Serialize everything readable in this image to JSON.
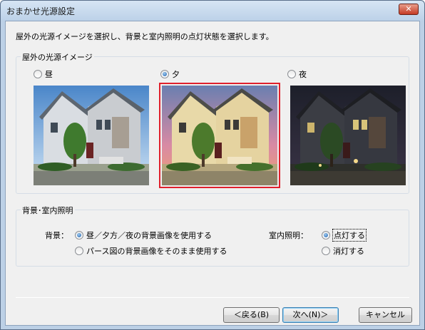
{
  "window": {
    "title": "おまかせ光源設定",
    "close_glyph": "✕"
  },
  "instruction": "屋外の光源イメージを選択し、背景と室内照明の点灯状態を選択します。",
  "light_group": {
    "label": "屋外の光源イメージ",
    "options": [
      {
        "label": "昼",
        "selected": false
      },
      {
        "label": "夕",
        "selected": true
      },
      {
        "label": "夜",
        "selected": false
      }
    ]
  },
  "bg_group": {
    "label": "背景･室内照明",
    "background": {
      "label": "背景：",
      "options": [
        {
          "label": "昼／夕方／夜の背景画像を使用する",
          "selected": true
        },
        {
          "label": "パース図の背景画像をそのまま使用する",
          "selected": false
        }
      ]
    },
    "interior": {
      "label": "室内照明：",
      "options": [
        {
          "label": "点灯する",
          "selected": true
        },
        {
          "label": "消灯する",
          "selected": false
        }
      ]
    }
  },
  "buttons": {
    "back": "＜戻る(B)",
    "next": "次へ(N)＞",
    "cancel": "キャンセル"
  },
  "colors": {
    "selection_frame": "#e0202c",
    "accent": "#1f5fa8"
  }
}
